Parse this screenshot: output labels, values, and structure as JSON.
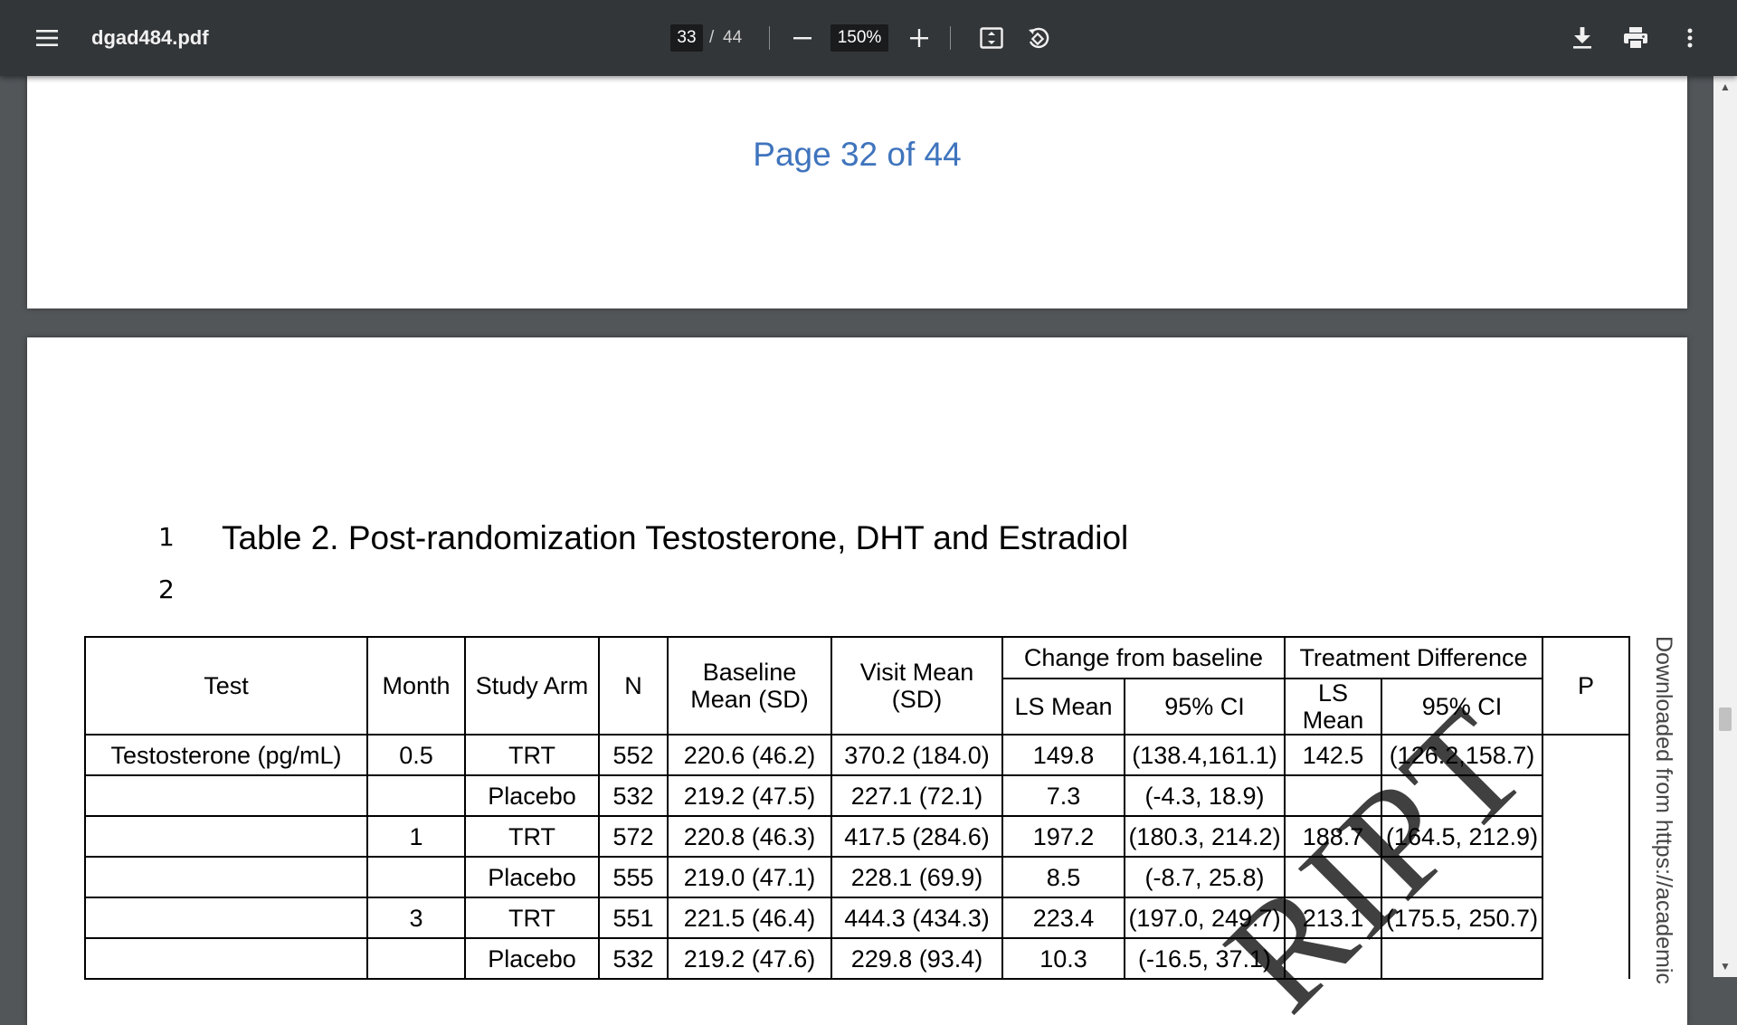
{
  "toolbar": {
    "file_name": "dgad484.pdf",
    "current_page": "33",
    "page_separator": "/",
    "total_pages": "44",
    "zoom": "150%",
    "icons": [
      "menu-icon",
      "zoom-out-icon",
      "zoom-in-icon",
      "fit-page-icon",
      "rotate-icon",
      "download-icon",
      "print-icon",
      "more-icon"
    ]
  },
  "prev_page": {
    "footer": "Page 32 of 44"
  },
  "page": {
    "line_numbers": [
      "1",
      "2"
    ],
    "table_title": "Table 2. Post-randomization Testosterone, DHT and Estradiol",
    "watermark": "RIPT",
    "side_text": "Downloaded from https://academic"
  },
  "table": {
    "headers": {
      "test": "Test",
      "month": "Month",
      "arm": "Study Arm",
      "n": "N",
      "baseline": "Baseline Mean (SD)",
      "visit": "Visit Mean (SD)",
      "change_group": "Change from baseline",
      "ls_mean": "LS Mean",
      "ci": "95% CI",
      "treat_group": "Treatment Difference",
      "treat_ls_mean": "LS Mean",
      "treat_ci": "95% CI",
      "p": "P"
    },
    "rows": [
      {
        "test": "Testosterone (pg/mL)",
        "month": "0.5",
        "arm": "TRT",
        "n": "552",
        "baseline": "220.6 (46.2)",
        "visit": "370.2 (184.0)",
        "ls_mean": "149.8",
        "ci": "(138.4,161.1)",
        "t_ls": "142.5",
        "t_ci": "(126.2,158.7)"
      },
      {
        "test": "",
        "month": "",
        "arm": "Placebo",
        "n": "532",
        "baseline": "219.2 (47.5)",
        "visit": "227.1 (72.1)",
        "ls_mean": "7.3",
        "ci": "(-4.3, 18.9)",
        "t_ls": "",
        "t_ci": ""
      },
      {
        "test": "",
        "month": "1",
        "arm": "TRT",
        "n": "572",
        "baseline": "220.8 (46.3)",
        "visit": "417.5 (284.6)",
        "ls_mean": "197.2",
        "ci": "(180.3, 214.2)",
        "t_ls": "188.7",
        "t_ci": "(164.5, 212.9)"
      },
      {
        "test": "",
        "month": "",
        "arm": "Placebo",
        "n": "555",
        "baseline": "219.0 (47.1)",
        "visit": "228.1 (69.9)",
        "ls_mean": "8.5",
        "ci": "(-8.7, 25.8)",
        "t_ls": "",
        "t_ci": ""
      },
      {
        "test": "",
        "month": "3",
        "arm": "TRT",
        "n": "551",
        "baseline": "221.5 (46.4)",
        "visit": "444.3 (434.3)",
        "ls_mean": "223.4",
        "ci": "(197.0, 249.7)",
        "t_ls": "213.1",
        "t_ci": "(175.5, 250.7)"
      },
      {
        "test": "",
        "month": "",
        "arm": "Placebo",
        "n": "532",
        "baseline": "219.2 (47.6)",
        "visit": "229.8 (93.4)",
        "ls_mean": "10.3",
        "ci": "(-16.5, 37.1)",
        "t_ls": "",
        "t_ci": ""
      }
    ]
  }
}
